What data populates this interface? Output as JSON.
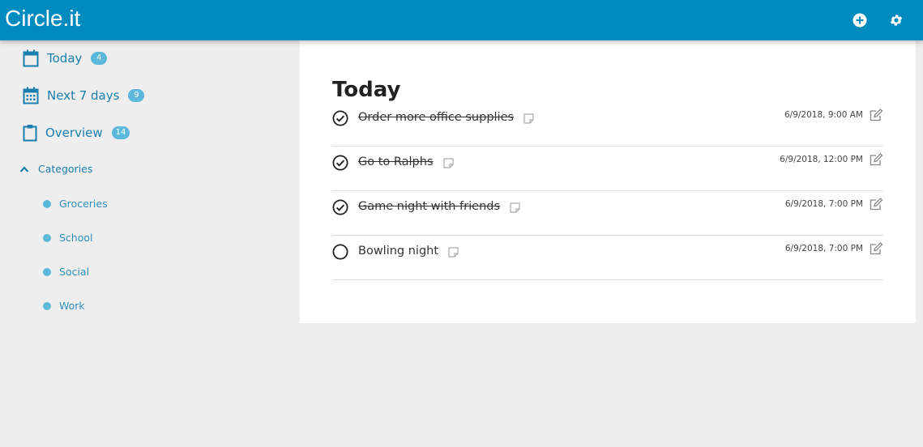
{
  "app": {
    "title": "Circle.it"
  },
  "sidebar": {
    "items": [
      {
        "label": "Today",
        "count": "4",
        "icon": "calendar-icon"
      },
      {
        "label": "Next 7 days",
        "count": "9",
        "icon": "calendar-grid-icon"
      },
      {
        "label": "Overview",
        "count": "14",
        "icon": "clipboard-icon"
      }
    ],
    "categories_label": "Categories",
    "categories": [
      "Groceries",
      "School",
      "Social",
      "Work"
    ]
  },
  "main": {
    "title": "Today",
    "tasks": [
      {
        "title": "Order more office supplies",
        "datetime": "6/9/2018, 9:00 AM",
        "done": true
      },
      {
        "title": "Go to Ralphs",
        "datetime": "6/9/2018, 12:00 PM",
        "done": true
      },
      {
        "title": "Game night with friends",
        "datetime": "6/9/2018, 7:00 PM",
        "done": true
      },
      {
        "title": "Bowling night",
        "datetime": "6/9/2018, 7:00 PM",
        "done": false
      }
    ]
  },
  "colors": {
    "header": "#008bbf",
    "accent": "#1a7fae",
    "badge": "#5bb8db",
    "background": "#eeeeee"
  }
}
